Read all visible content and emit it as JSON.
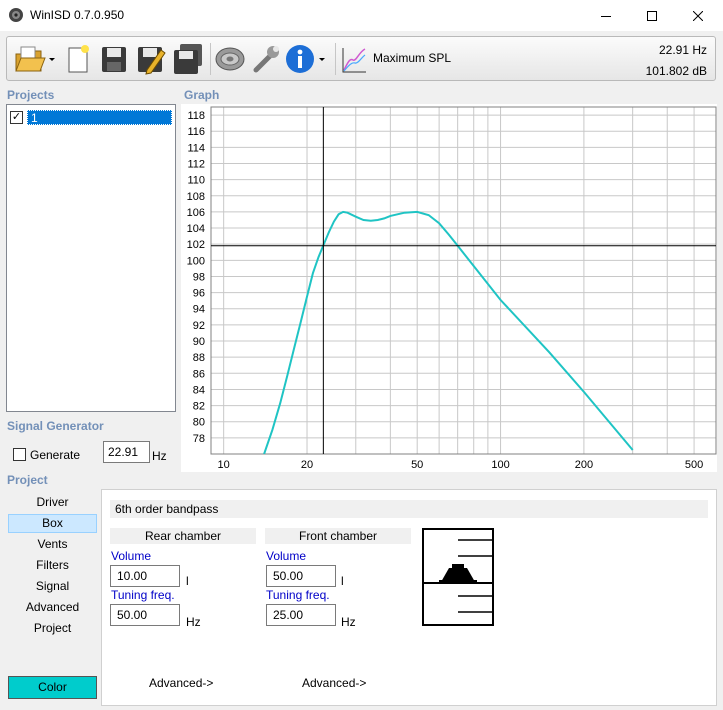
{
  "window": {
    "title": "WinISD 0.7.0.950"
  },
  "icons": {
    "app": "speaker-app-icon",
    "minimize": "minimize-icon",
    "maximize": "maximize-icon",
    "close": "close-icon",
    "open": "open-folder-icon",
    "new": "new-document-icon",
    "save": "save-icon",
    "edit": "edit-icon",
    "save_all": "save-all-icon",
    "driver": "driver-icon",
    "tools": "wrench-icon",
    "info": "info-icon",
    "chart_mode": "spl-chart-icon"
  },
  "toolbar": {
    "mode_label": "Maximum SPL",
    "readout_freq": "22.91 Hz",
    "readout_db": "101.802 dB"
  },
  "sections": {
    "projects": "Projects",
    "graph": "Graph",
    "signal_generator": "Signal Generator",
    "project": "Project"
  },
  "projects": [
    {
      "name": "1",
      "checked": true
    }
  ],
  "signal_generator": {
    "generate_label": "Generate",
    "frequency": "22.91",
    "unit": "Hz"
  },
  "project_nav": {
    "items": [
      "Driver",
      "Box",
      "Vents",
      "Filters",
      "Signal",
      "Advanced",
      "Project"
    ],
    "active": "Box",
    "color_button": "Color"
  },
  "box": {
    "type": "6th order bandpass",
    "rear": {
      "header": "Rear chamber",
      "volume_label": "Volume",
      "volume": "10.00",
      "volume_unit": "l",
      "tuning_label": "Tuning freq.",
      "tuning": "50.00",
      "tuning_unit": "Hz",
      "advanced": "Advanced->"
    },
    "front": {
      "header": "Front chamber",
      "volume_label": "Volume",
      "volume": "50.00",
      "volume_unit": "l",
      "tuning_label": "Tuning freq.",
      "tuning": "25.00",
      "tuning_unit": "Hz",
      "advanced": "Advanced->"
    }
  },
  "colors": {
    "curve": "#1fc4c4",
    "selection": "#0078d7",
    "heading": "#7390b8",
    "color_button": "#00cccc"
  },
  "chart_data": {
    "type": "line",
    "x_scale": "log",
    "xlim": [
      9,
      600
    ],
    "ylim": [
      76,
      119
    ],
    "x_ticks": [
      10,
      20,
      50,
      100,
      200,
      500
    ],
    "y_ticks": [
      78,
      80,
      82,
      84,
      86,
      88,
      90,
      92,
      94,
      96,
      98,
      100,
      102,
      104,
      106,
      108,
      110,
      112,
      114,
      116,
      118
    ],
    "grid": true,
    "cursor": {
      "x": 22.91,
      "y": 101.802
    },
    "series": [
      {
        "color": "#1fc4c4",
        "x": [
          14,
          15,
          16,
          17,
          18,
          19,
          20,
          21,
          22,
          23,
          24,
          25,
          26,
          27,
          28,
          30,
          32,
          34,
          36,
          38,
          40,
          45,
          50,
          55,
          60,
          65,
          70,
          80,
          100,
          150,
          200,
          300
        ],
        "y": [
          76,
          79,
          82.3,
          85.8,
          89.2,
          92.4,
          95.5,
          98.4,
          100.4,
          102.0,
          103.5,
          104.8,
          105.7,
          106.0,
          105.9,
          105.4,
          105.0,
          104.9,
          105.0,
          105.2,
          105.5,
          105.9,
          106.0,
          105.6,
          104.6,
          103.2,
          101.8,
          99.3,
          95.1,
          88.6,
          83.7,
          76.5
        ]
      }
    ]
  }
}
